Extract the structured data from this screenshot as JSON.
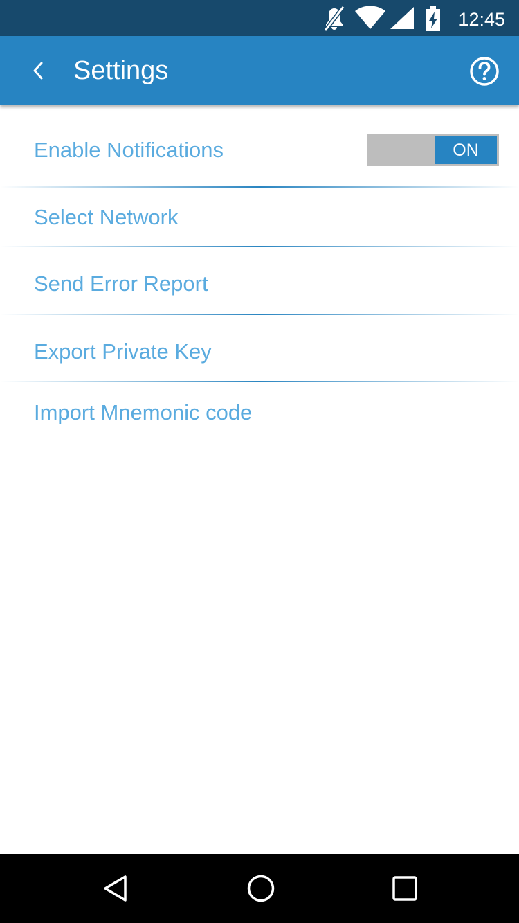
{
  "status_bar": {
    "time": "12:45",
    "icons": [
      "mute-icon",
      "wifi-icon",
      "signal-icon",
      "battery-charging-icon"
    ]
  },
  "app_bar": {
    "title": "Settings",
    "back_icon": "chevron-left-icon",
    "help_icon": "help-circle-icon",
    "background_color": "#2784c2"
  },
  "settings": {
    "items": [
      {
        "label": "Enable Notifications",
        "toggle": {
          "state": "ON"
        }
      },
      {
        "label": "Select Network"
      },
      {
        "label": "Send Error Report"
      },
      {
        "label": "Export Private Key"
      },
      {
        "label": "Import Mnemonic code"
      }
    ],
    "label_color": "#5aabdf"
  },
  "nav_bar": {
    "buttons": [
      "back-triangle-icon",
      "home-circle-icon",
      "recents-square-icon"
    ]
  }
}
